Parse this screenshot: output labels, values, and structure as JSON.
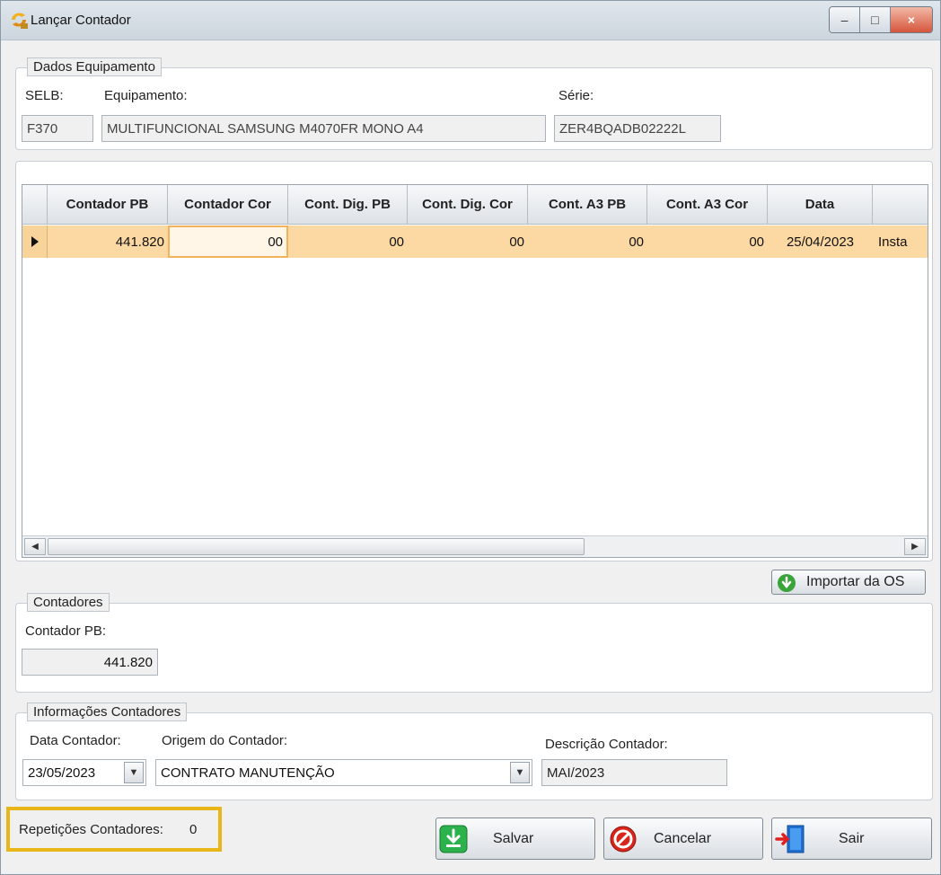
{
  "window": {
    "title": "Lançar Contador",
    "controls": {
      "minimize": "–",
      "maximize": "□",
      "close": "×"
    }
  },
  "dados_equipamento": {
    "legend": "Dados Equipamento",
    "selb_label": "SELB:",
    "selb_value": "F370",
    "equipamento_label": "Equipamento:",
    "equipamento_value": "MULTIFUNCIONAL SAMSUNG M4070FR MONO A4",
    "serie_label": "Série:",
    "serie_value": "ZER4BQADB02222L"
  },
  "grid": {
    "columns": [
      "Contador PB",
      "Contador Cor",
      "Cont. Dig. PB",
      "Cont. Dig. Cor",
      "Cont. A3 PB",
      "Cont. A3 Cor",
      "Data",
      ""
    ],
    "row": {
      "contador_pb": "441.820",
      "contador_cor": "00",
      "cont_dig_pb": "00",
      "cont_dig_cor": "00",
      "cont_a3_pb": "00",
      "cont_a3_cor": "00",
      "data": "25/04/2023",
      "extra": "Insta"
    }
  },
  "importar_button": {
    "label": "Importar da OS"
  },
  "contadores": {
    "legend": "Contadores",
    "contador_pb_label": "Contador PB:",
    "contador_pb_value": "441.820"
  },
  "informacoes": {
    "legend": "Informações Contadores",
    "data_label": "Data Contador:",
    "data_value": "23/05/2023",
    "origem_label": "Origem do Contador:",
    "origem_value": "CONTRATO MANUTENÇÃO",
    "descricao_label": "Descrição Contador:",
    "descricao_value": "MAI/2023"
  },
  "repeticoes": {
    "label": "Repetições Contadores:",
    "value": "0"
  },
  "actions": {
    "salvar": "Salvar",
    "cancelar": "Cancelar",
    "sair": "Sair"
  },
  "colors": {
    "row_highlight": "#fcd9a2",
    "highlight_box": "#e9b61a"
  }
}
